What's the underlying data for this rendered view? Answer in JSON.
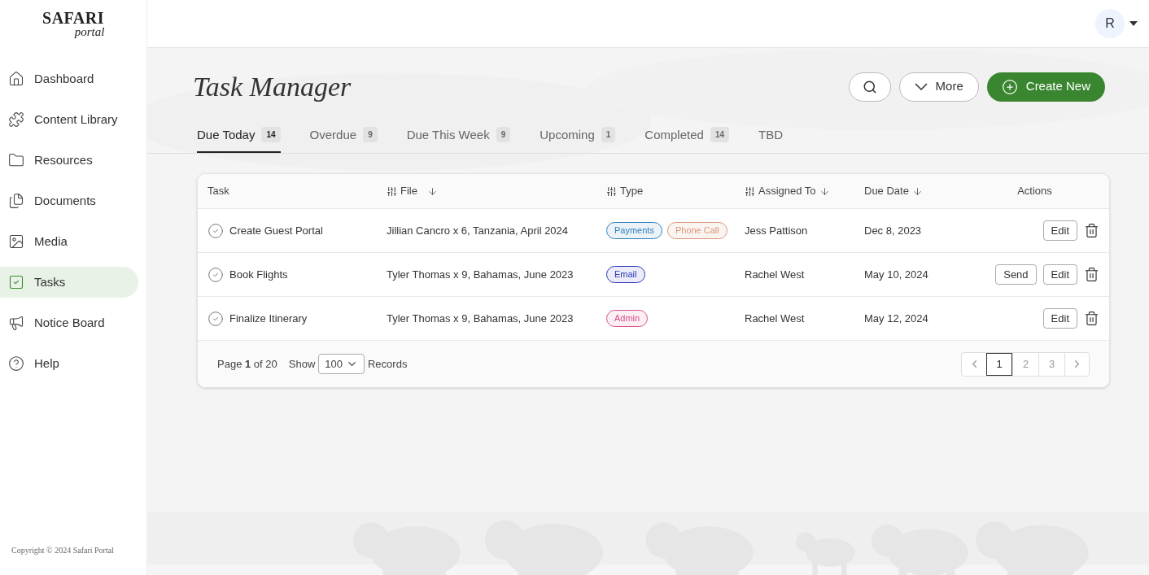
{
  "logo": {
    "title": "SAFARI",
    "subtitle": "portal"
  },
  "sidebar": {
    "items": [
      {
        "label": "Dashboard",
        "selected": false
      },
      {
        "label": "Content Library",
        "selected": false
      },
      {
        "label": "Resources",
        "selected": false
      },
      {
        "label": "Documents",
        "selected": false
      },
      {
        "label": "Media",
        "selected": false
      },
      {
        "label": "Tasks",
        "selected": true
      },
      {
        "label": "Notice Board",
        "selected": false
      },
      {
        "label": "Help",
        "selected": false
      }
    ],
    "copyright": "Copyright © 2024 Safari Portal"
  },
  "user": {
    "initial": "R"
  },
  "page": {
    "title": "Task Manager",
    "more_label": "More",
    "create_label": "Create New"
  },
  "tabs": [
    {
      "label": "Due Today",
      "count": "14",
      "selected": true
    },
    {
      "label": "Overdue",
      "count": "9",
      "selected": false
    },
    {
      "label": "Due This Week",
      "count": "9",
      "selected": false
    },
    {
      "label": "Upcoming",
      "count": "1",
      "selected": false
    },
    {
      "label": "Completed",
      "count": "14",
      "selected": false
    },
    {
      "label": "TBD",
      "selected": false
    }
  ],
  "table": {
    "columns": [
      {
        "label": "Task",
        "filter": false,
        "sort": false
      },
      {
        "label": "File",
        "filter": true,
        "sort": true
      },
      {
        "label": "Type",
        "filter": true,
        "sort": false
      },
      {
        "label": "Assigned To",
        "filter": true,
        "sort": true
      },
      {
        "label": "Due Date",
        "filter": false,
        "sort": true
      },
      {
        "label": "Actions",
        "filter": false,
        "sort": false
      }
    ],
    "rows": [
      {
        "task": "Create Guest Portal",
        "file": "Jillian Cancro x 6, Tanzania, April 2024",
        "tags": [
          {
            "label": "Payments",
            "color": "#2f80b8"
          },
          {
            "label": "Phone Call",
            "color": "#d9957a"
          }
        ],
        "assigned": "Jess Pattison",
        "due": "Dec 8, 2023",
        "actions": [
          "Edit"
        ]
      },
      {
        "task": "Book Flights",
        "file": "Tyler Thomas x 9, Bahamas, June 2023",
        "tags": [
          {
            "label": "Email",
            "color": "#2a36b8"
          }
        ],
        "assigned": "Rachel West",
        "due": "May 10, 2024",
        "actions": [
          "Send",
          "Edit"
        ]
      },
      {
        "task": "Finalize Itinerary",
        "file": "Tyler Thomas x 9, Bahamas, June 2023",
        "tags": [
          {
            "label": "Admin",
            "color": "#d9508e"
          }
        ],
        "assigned": "Rachel West",
        "due": "May 12, 2024",
        "actions": [
          "Edit"
        ]
      }
    ]
  },
  "footer": {
    "page_info": "Page **1** of 20",
    "show_label": "Show",
    "page_size": "100",
    "records_label": "Records",
    "pages": [
      {
        "label": "1",
        "selected": true
      },
      {
        "label": "2",
        "selected": false
      },
      {
        "label": "3",
        "selected": false
      }
    ]
  }
}
